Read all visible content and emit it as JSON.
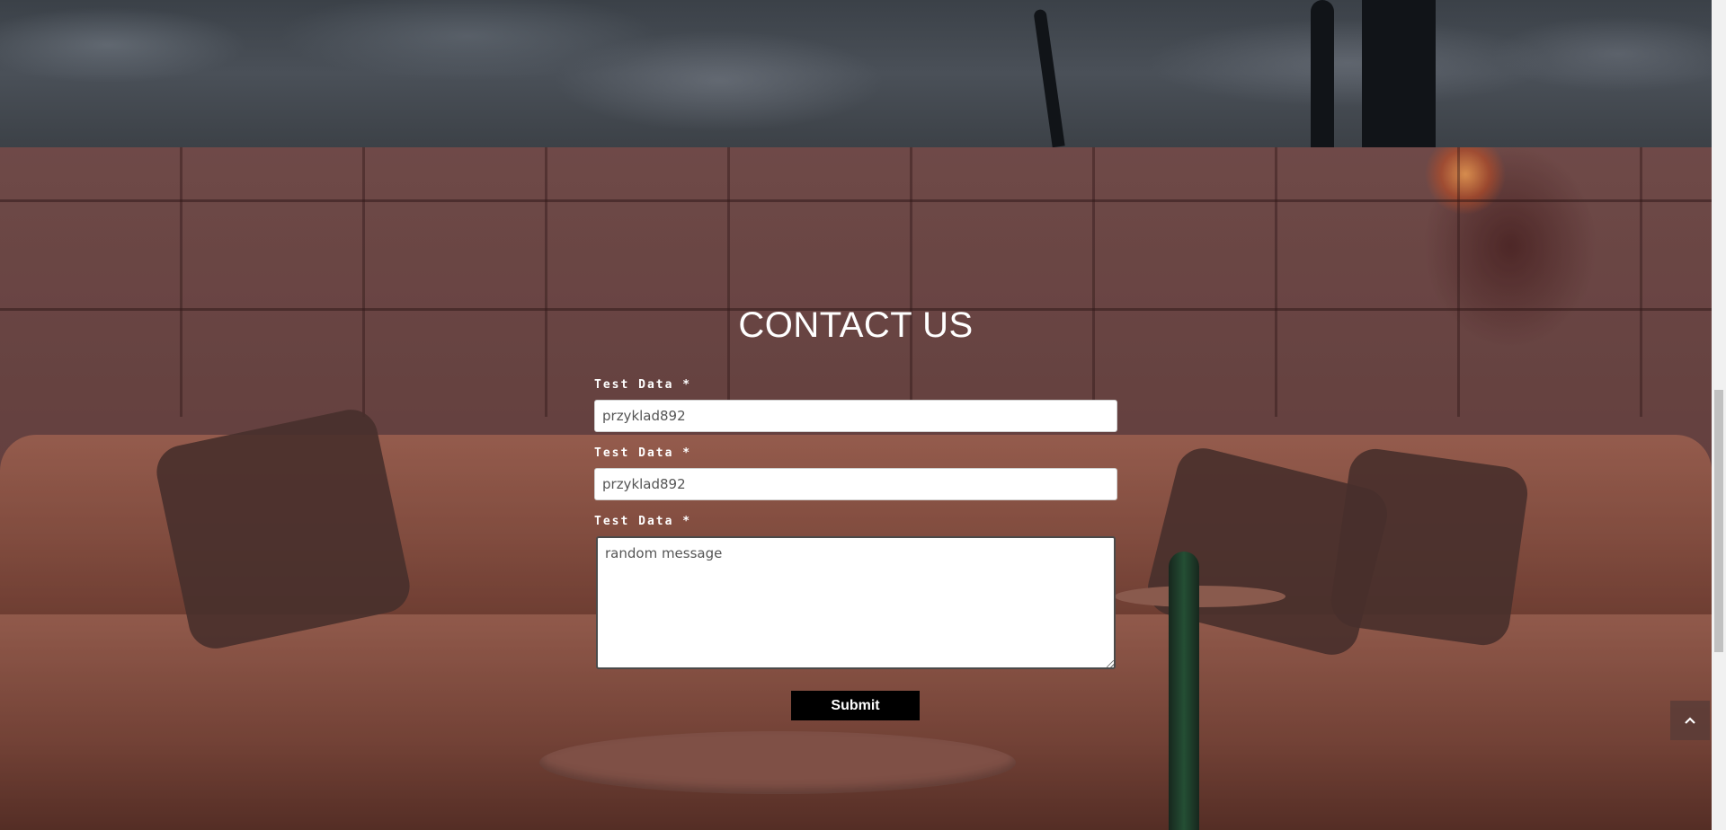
{
  "contact": {
    "title": "CONTACT US",
    "fields": [
      {
        "label": "Test Data *",
        "value": "przyklad892"
      },
      {
        "label": "Test Data *",
        "value": "przyklad892"
      },
      {
        "label": "Test Data *",
        "value": "random message"
      }
    ],
    "submit_label": "Submit"
  },
  "icons": {
    "scroll_top": "chevron-up-icon"
  },
  "colors": {
    "submit_bg": "#000000",
    "submit_text": "#ffffff",
    "title_text": "#ffffff"
  }
}
